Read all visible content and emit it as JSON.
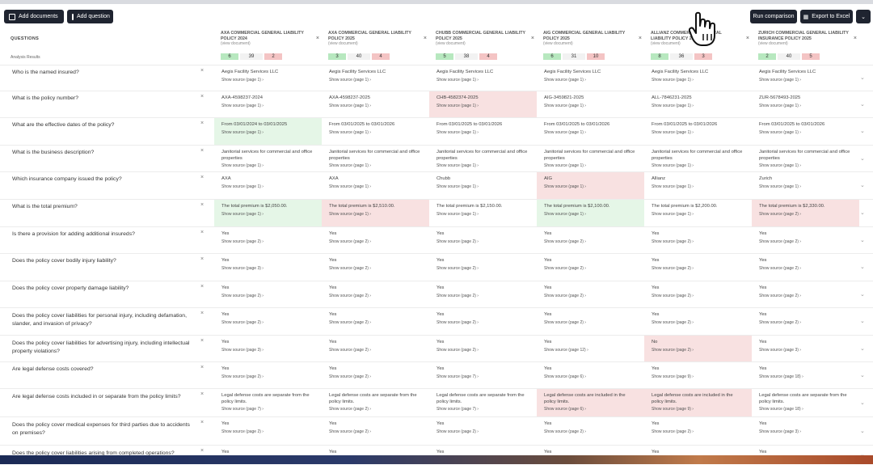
{
  "toolbar": {
    "add_documents": "Add documents",
    "add_question": "Add question",
    "run_comparison": "Run comparison",
    "export_excel": "Export to Excel",
    "more": "⌄"
  },
  "table": {
    "questions_header": "QUESTIONS",
    "analysis_label": "Analysis Results",
    "columns": [
      {
        "title": "AXA COMMERCIAL GENERAL LIABILITY POLICY 2024",
        "view": "(view document)",
        "green": "6",
        "neutral": "39",
        "red": "2"
      },
      {
        "title": "AXA COMMERCIAL GENERAL LIABILITY POLICY 2025",
        "view": "(view document)",
        "green": "3",
        "neutral": "40",
        "red": "4"
      },
      {
        "title": "CHUBB COMMERCIAL GENERAL LIABILITY POLICY 2025",
        "view": "(view document)",
        "green": "5",
        "neutral": "38",
        "red": "4"
      },
      {
        "title": "AIG COMMERCIAL GENERAL LIABILITY POLICY 2025",
        "view": "(view document)",
        "green": "6",
        "neutral": "31",
        "red": "10"
      },
      {
        "title": "ALLIANZ COMMERCIAL GENERAL LIABILITY POLICY 2025",
        "view": "(view document)",
        "green": "8",
        "neutral": "36",
        "red": "3"
      },
      {
        "title": "ZURICH COMMERCIAL GENERAL LIABILITY INSURANCE POLICY 2025",
        "view": "(view document)",
        "green": "2",
        "neutral": "40",
        "red": "5"
      }
    ],
    "rows": [
      {
        "q": "Who is the named insured?",
        "cells": [
          {
            "v": "Aegis Facility Services LLC",
            "s": "Show source (page 1)  ›",
            "st": ""
          },
          {
            "v": "Aegis Facility Services LLC",
            "s": "Show source (page 1)  ›",
            "st": ""
          },
          {
            "v": "Aegis Facility Services LLC",
            "s": "Show source (page 1)  ›",
            "st": ""
          },
          {
            "v": "Aegis Facility Services LLC",
            "s": "Show source (page 1)  ›",
            "st": ""
          },
          {
            "v": "Aegis Facility Services LLC",
            "s": "Show source (page 1)  ›",
            "st": ""
          },
          {
            "v": "Aegis Facility Services LLC",
            "s": "Show source (page 1)  ›",
            "st": ""
          }
        ]
      },
      {
        "q": "What is the policy number?",
        "cells": [
          {
            "v": "AXA-4598237-2024",
            "s": "Show source (page 1)  ›",
            "st": ""
          },
          {
            "v": "AXA-4598237-2025",
            "s": "Show source (page 1)  ›",
            "st": ""
          },
          {
            "v": "CHB-4582374-2025",
            "s": "Show source (page 1)  ›",
            "st": "red"
          },
          {
            "v": "AIG-3459821-2025",
            "s": "Show source (page 1)  ›",
            "st": ""
          },
          {
            "v": "ALL-7846231-2025",
            "s": "Show source (page 1)  ›",
            "st": ""
          },
          {
            "v": "ZUR-5678493-2025",
            "s": "Show source (page 1)  ›",
            "st": ""
          }
        ]
      },
      {
        "q": "What are the effective dates of the policy?",
        "cells": [
          {
            "v": "From 03/01/2024 to 03/01/2025",
            "s": "Show source (page 1)  ›",
            "st": "green"
          },
          {
            "v": "From 03/01/2025 to 03/01/2026",
            "s": "Show source (page 1)  ›",
            "st": ""
          },
          {
            "v": "From 03/01/2025 to 03/01/2026",
            "s": "Show source (page 1)  ›",
            "st": ""
          },
          {
            "v": "From 03/01/2025 to 03/01/2026",
            "s": "Show source (page 1)  ›",
            "st": ""
          },
          {
            "v": "From 03/01/2025 to 03/01/2026",
            "s": "Show source (page 1)  ›",
            "st": ""
          },
          {
            "v": "From 03/01/2025 to 03/01/2026",
            "s": "Show source (page 1)  ›",
            "st": ""
          }
        ]
      },
      {
        "q": "What is the business description?",
        "cells": [
          {
            "v": "Janitorial services for commercial and office properties",
            "s": "Show source (page 1)  ›",
            "st": ""
          },
          {
            "v": "Janitorial services for commercial and office properties",
            "s": "Show source (page 1)  ›",
            "st": ""
          },
          {
            "v": "Janitorial services for commercial and office properties",
            "s": "Show source (page 1)  ›",
            "st": ""
          },
          {
            "v": "Janitorial services for commercial and office properties",
            "s": "Show source (page 1)  ›",
            "st": ""
          },
          {
            "v": "Janitorial services for commercial and office properties",
            "s": "Show source (page 1)  ›",
            "st": ""
          },
          {
            "v": "Janitorial services for commercial and office properties",
            "s": "Show source (page 1)  ›",
            "st": ""
          }
        ]
      },
      {
        "q": "Which insurance company issued the policy?",
        "cells": [
          {
            "v": "AXA",
            "s": "Show source (page 1)  ›",
            "st": ""
          },
          {
            "v": "AXA",
            "s": "Show source (page 1)  ›",
            "st": ""
          },
          {
            "v": "Chubb",
            "s": "Show source (page 1)  ›",
            "st": ""
          },
          {
            "v": "AIG",
            "s": "Show source (page 1)  ›",
            "st": "red"
          },
          {
            "v": "Allianz",
            "s": "Show source (page 1)  ›",
            "st": ""
          },
          {
            "v": "Zurich",
            "s": "Show source (page 1)  ›",
            "st": ""
          }
        ]
      },
      {
        "q": "What is the total premium?",
        "cells": [
          {
            "v": "The total premium is $2,050.00.",
            "s": "Show source (page 1)  ›",
            "st": "green"
          },
          {
            "v": "The total premium is $2,510.00.",
            "s": "Show source (page 1)  ›",
            "st": "red"
          },
          {
            "v": "The total premium is $2,150.00.",
            "s": "Show source (page 1)  ›",
            "st": ""
          },
          {
            "v": "The total premium is $2,100.00.",
            "s": "Show source (page 1)  ›",
            "st": "green"
          },
          {
            "v": "The total premium is $2,200.00.",
            "s": "Show source (page 1)  ›",
            "st": ""
          },
          {
            "v": "The total premium is $2,330.00.",
            "s": "Show source (page 2)  ›",
            "st": "red"
          }
        ]
      },
      {
        "q": "Is there a provision for adding additional insureds?",
        "cells": [
          {
            "v": "Yes",
            "s": "Show source (page 2)  ›",
            "st": ""
          },
          {
            "v": "Yes",
            "s": "Show source (page 2)  ›",
            "st": ""
          },
          {
            "v": "Yes",
            "s": "Show source (page 2)  ›",
            "st": ""
          },
          {
            "v": "Yes",
            "s": "Show source (page 2)  ›",
            "st": ""
          },
          {
            "v": "Yes",
            "s": "Show source (page 2)  ›",
            "st": ""
          },
          {
            "v": "Yes",
            "s": "Show source (page 2)  ›",
            "st": ""
          }
        ]
      },
      {
        "q": "Does the policy cover bodily injury liability?",
        "cells": [
          {
            "v": "Yes",
            "s": "Show source (page 3)  ›",
            "st": ""
          },
          {
            "v": "Yes",
            "s": "Show source (page 2)  ›",
            "st": ""
          },
          {
            "v": "Yes",
            "s": "Show source (page 2)  ›",
            "st": ""
          },
          {
            "v": "Yes",
            "s": "Show source (page 2)  ›",
            "st": ""
          },
          {
            "v": "Yes",
            "s": "Show source (page 2)  ›",
            "st": ""
          },
          {
            "v": "Yes",
            "s": "Show source (page 2)  ›",
            "st": ""
          }
        ]
      },
      {
        "q": "Does the policy cover property damage liability?",
        "cells": [
          {
            "v": "Yes",
            "s": "Show source (page 2)  ›",
            "st": ""
          },
          {
            "v": "Yes",
            "s": "Show source (page 2)  ›",
            "st": ""
          },
          {
            "v": "Yes",
            "s": "Show source (page 2)  ›",
            "st": ""
          },
          {
            "v": "Yes",
            "s": "Show source (page 2)  ›",
            "st": ""
          },
          {
            "v": "Yes",
            "s": "Show source (page 2)  ›",
            "st": ""
          },
          {
            "v": "Yes",
            "s": "Show source (page 2)  ›",
            "st": ""
          }
        ]
      },
      {
        "q": "Does the policy cover liabilities for personal injury, including defamation, slander, and invasion of privacy?",
        "cells": [
          {
            "v": "Yes",
            "s": "Show source (page 2)  ›",
            "st": ""
          },
          {
            "v": "Yes",
            "s": "Show source (page 2)  ›",
            "st": ""
          },
          {
            "v": "Yes",
            "s": "Show source (page 2)  ›",
            "st": ""
          },
          {
            "v": "Yes",
            "s": "Show source (page 2)  ›",
            "st": ""
          },
          {
            "v": "Yes",
            "s": "Show source (page 2)  ›",
            "st": ""
          },
          {
            "v": "Yes",
            "s": "Show source (page 2)  ›",
            "st": ""
          }
        ]
      },
      {
        "q": "Does the policy cover liabilities for advertising injury, including intellectual property violations?",
        "cells": [
          {
            "v": "Yes",
            "s": "Show source (page 3)  ›",
            "st": ""
          },
          {
            "v": "Yes",
            "s": "Show source (page 2)  ›",
            "st": ""
          },
          {
            "v": "Yes",
            "s": "Show source (page 2)  ›",
            "st": ""
          },
          {
            "v": "Yes",
            "s": "Show source (page 12)  ›",
            "st": ""
          },
          {
            "v": "No",
            "s": "Show source (page 2)  ›",
            "st": "red"
          },
          {
            "v": "Yes",
            "s": "Show source (page 3)  ›",
            "st": ""
          }
        ]
      },
      {
        "q": "Are legal defense costs covered?",
        "cells": [
          {
            "v": "Yes",
            "s": "Show source (page 2)  ›",
            "st": ""
          },
          {
            "v": "Yes",
            "s": "Show source (page 2)  ›",
            "st": ""
          },
          {
            "v": "Yes",
            "s": "Show source (page 7)  ›",
            "st": ""
          },
          {
            "v": "Yes",
            "s": "Show source (page 6)  ›",
            "st": ""
          },
          {
            "v": "Yes",
            "s": "Show source (page 9)  ›",
            "st": ""
          },
          {
            "v": "Yes",
            "s": "Show source (page 18)  ›",
            "st": ""
          }
        ]
      },
      {
        "q": "Are legal defense costs included in or separate from the policy limits?",
        "cells": [
          {
            "v": "Legal defense costs are separate from the policy limits.",
            "s": "Show source (page 7)  ›",
            "st": ""
          },
          {
            "v": "Legal defense costs are separate from the policy limits.",
            "s": "Show source (page 2)  ›",
            "st": ""
          },
          {
            "v": "Legal defense costs are separate from the policy limits.",
            "s": "Show source (page 7)  ›",
            "st": ""
          },
          {
            "v": "Legal defense costs are included in the policy limits.",
            "s": "Show source (page 6)  ›",
            "st": "red"
          },
          {
            "v": "Legal defense costs are included in the policy limits.",
            "s": "Show source (page 9)  ›",
            "st": "red"
          },
          {
            "v": "Legal defense costs are separate from the policy limits.",
            "s": "Show source (page 18)  ›",
            "st": ""
          }
        ]
      },
      {
        "q": "Does the policy cover medical expenses for third parties due to accidents on premises?",
        "cells": [
          {
            "v": "Yes",
            "s": "Show source (page 2)  ›",
            "st": ""
          },
          {
            "v": "Yes",
            "s": "Show source (page 2)  ›",
            "st": ""
          },
          {
            "v": "Yes",
            "s": "Show source (page 2)  ›",
            "st": ""
          },
          {
            "v": "Yes",
            "s": "Show source (page 2)  ›",
            "st": ""
          },
          {
            "v": "Yes",
            "s": "Show source (page 2)  ›",
            "st": ""
          },
          {
            "v": "Yes",
            "s": "Show source (page 3)  ›",
            "st": ""
          }
        ]
      },
      {
        "q": "Does the policy cover liabilities arising from completed operations?",
        "cells": [
          {
            "v": "Yes",
            "s": "",
            "st": ""
          },
          {
            "v": "Yes",
            "s": "",
            "st": ""
          },
          {
            "v": "Yes",
            "s": "",
            "st": ""
          },
          {
            "v": "Yes",
            "s": "",
            "st": ""
          },
          {
            "v": "Yes",
            "s": "",
            "st": ""
          },
          {
            "v": "Yes",
            "s": "",
            "st": ""
          }
        ]
      }
    ]
  }
}
